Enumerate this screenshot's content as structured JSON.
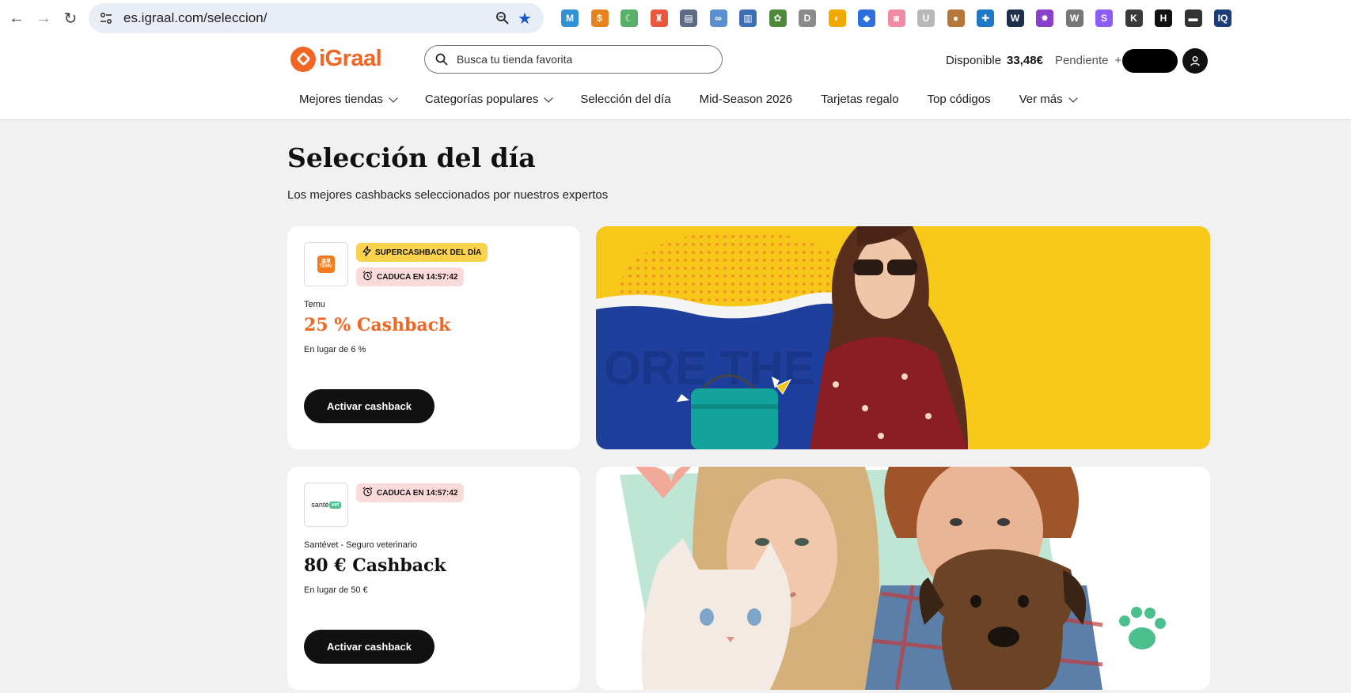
{
  "browser": {
    "url": "es.igraal.com/seleccion/",
    "extensions": [
      {
        "name": "m-extension-icon",
        "color": "#2f93d6",
        "glyph": "M"
      },
      {
        "name": "cashback-extension-icon",
        "color": "#e8821e",
        "glyph": "$"
      },
      {
        "name": "moon-extension-icon",
        "color": "#58b06b",
        "glyph": "☾"
      },
      {
        "name": "chess-extension-icon",
        "color": "#e9583d",
        "glyph": "♜"
      },
      {
        "name": "card-extension-icon",
        "color": "#5d6b86",
        "glyph": "▤"
      },
      {
        "name": "link-extension-icon",
        "color": "#5a8fd1",
        "glyph": "∞"
      },
      {
        "name": "chart-extension-icon",
        "color": "#3d6fb5",
        "glyph": "▥"
      },
      {
        "name": "puzzle-extension-icon",
        "color": "#4e8a3c",
        "glyph": "✿"
      },
      {
        "name": "d-extension-icon",
        "color": "#8a8a8a",
        "glyph": "D"
      },
      {
        "name": "google-extension-icon",
        "color": "#f2a900",
        "glyph": "◐"
      },
      {
        "name": "tag-extension-icon",
        "color": "#2d6fdc",
        "glyph": "◆"
      },
      {
        "name": "camera-extension-icon",
        "color": "#f38aa3",
        "glyph": "◙"
      },
      {
        "name": "u-extension-icon",
        "color": "#b8b8b8",
        "glyph": "U"
      },
      {
        "name": "cookie-extension-icon",
        "color": "#b7773b",
        "glyph": "●"
      },
      {
        "name": "compass-extension-icon",
        "color": "#1e78c8",
        "glyph": "✚"
      },
      {
        "name": "web-extension-icon",
        "color": "#1d2f4a",
        "glyph": "W"
      },
      {
        "name": "star-extension-icon",
        "color": "#8a3ec9",
        "glyph": "✸"
      },
      {
        "name": "w-extension-icon",
        "color": "#777777",
        "glyph": "W"
      },
      {
        "name": "s-extension-icon",
        "color": "#8b5cf6",
        "glyph": "S"
      },
      {
        "name": "k-extension-icon",
        "color": "#3a3a3a",
        "glyph": "K"
      },
      {
        "name": "h-extension-icon",
        "color": "#111111",
        "glyph": "H"
      },
      {
        "name": "monitor-extension-icon",
        "color": "#333333",
        "glyph": "▬"
      },
      {
        "name": "iq-extension-icon",
        "color": "#1b3d7a",
        "glyph": "IQ"
      }
    ]
  },
  "header": {
    "logo_text": "iGraal",
    "search_placeholder": "Busca tu tienda favorita",
    "available_label": "Disponible",
    "available_amount": "33,48€",
    "pending_label": "Pendiente",
    "pending_amount": "+"
  },
  "menu": [
    {
      "label": "Mejores tiendas",
      "dropdown": true
    },
    {
      "label": "Categorías populares",
      "dropdown": true
    },
    {
      "label": "Selección del día",
      "dropdown": false
    },
    {
      "label": "Mid-Season 2026",
      "dropdown": false
    },
    {
      "label": "Tarjetas regalo",
      "dropdown": false
    },
    {
      "label": "Top códigos",
      "dropdown": false
    },
    {
      "label": "Ver más",
      "dropdown": true
    }
  ],
  "page": {
    "title": "Selección del día",
    "subtitle": "Los mejores cashbacks seleccionados por nuestros expertos"
  },
  "offers": [
    {
      "store": "Temu",
      "logo_text": "温享 TEMU",
      "super_badge": "SUPERCASHBACK DEL DÍA",
      "expire_badge": "CADUCA EN 14:57:42",
      "cashback": "25 % Cashback",
      "cashback_color": "#f26522",
      "was": "En lugar de 6 %",
      "cta": "Activar cashback"
    },
    {
      "store": "Santévet - Seguro veterinario",
      "logo_text": "santé",
      "logo_badge": "vet",
      "expire_badge": "CADUCA EN 14:57:42",
      "cashback": "80 € Cashback",
      "cashback_color": "#111111",
      "was": "En lugar de 50 €",
      "cta": "Activar cashback"
    }
  ],
  "colors": {
    "brand": "#f26522",
    "banner1_bg": "#f7c81a",
    "banner1_blue": "#1e3f9c",
    "banner2_bg": "#ffffff",
    "banner2_mint": "#bfe6d4"
  }
}
